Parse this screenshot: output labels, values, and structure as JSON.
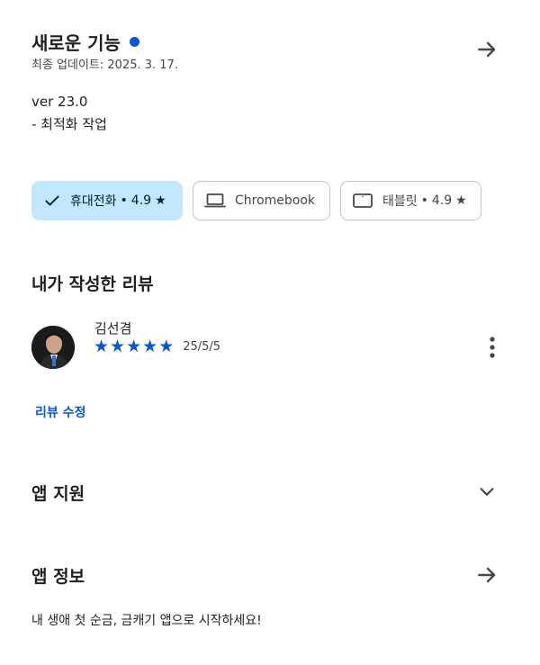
{
  "whats_new": {
    "title": "새로운 기능",
    "last_updated": "최종 업데이트: 2025. 3. 17.",
    "version": "ver 23.0",
    "note": "- 최적화 작업"
  },
  "devices": [
    {
      "label": "휴대전화",
      "rating": "4.9",
      "selected": true
    },
    {
      "label": "Chromebook",
      "selected": false
    },
    {
      "label": "태블릿",
      "rating": "4.9",
      "selected": false
    }
  ],
  "separator": "•",
  "star_glyph": "★",
  "my_review": {
    "heading": "내가 작성한 리뷰",
    "reviewer": "김선겸",
    "date": "25/5/5",
    "rating": 5,
    "edit_label": "리뷰 수정"
  },
  "app_support": {
    "title": "앱 지원"
  },
  "app_info": {
    "title": "앱 정보",
    "description": "내 생애 첫 순금, 금캐기 앱으로 시작하세요!"
  },
  "colors": {
    "accent": "#0b57d0",
    "chip_selected_bg": "#c2e7ff",
    "text": "#1f1f1f"
  }
}
